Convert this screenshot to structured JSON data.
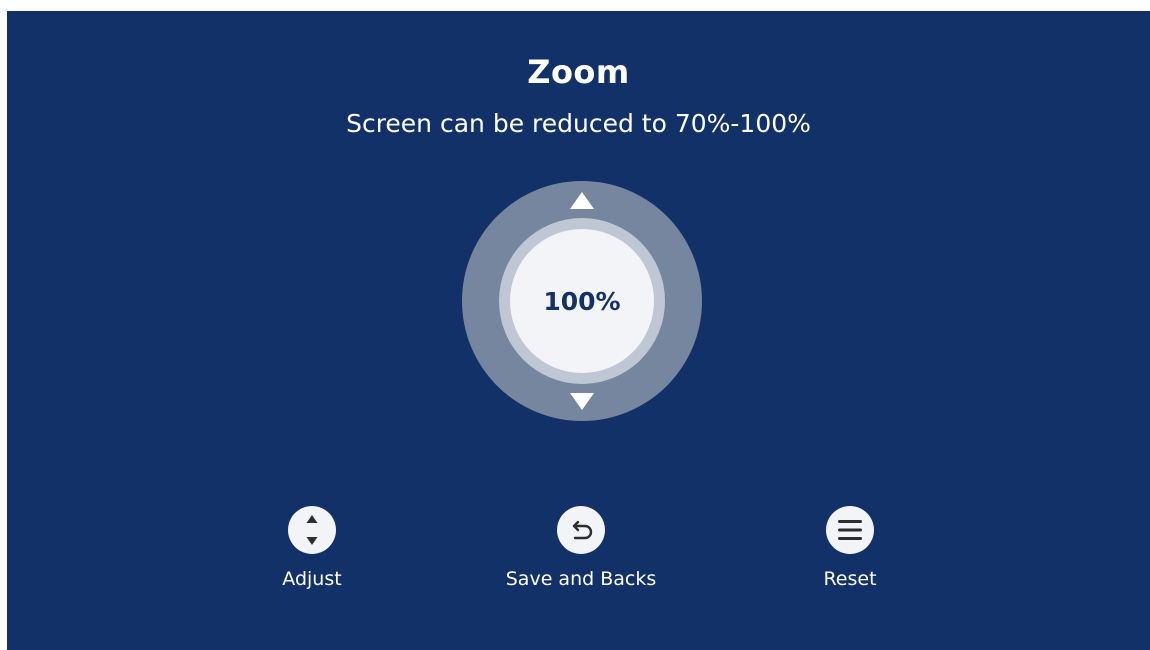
{
  "zoom": {
    "title": "Zoom",
    "subtitle": "Screen can be reduced to 70%-100%",
    "value_label": "100%",
    "value": 100,
    "range": [
      70,
      100
    ]
  },
  "hints": [
    {
      "label": "Adjust",
      "icon": "up-down-icon"
    },
    {
      "label": "Save and Backs",
      "icon": "return-icon"
    },
    {
      "label": "Reset",
      "icon": "menu-icon"
    }
  ],
  "colors": {
    "background": "#133169",
    "dial_outer": "#76869f",
    "dial_ring": "#c0c7d4",
    "dial_center": "#f3f4f7",
    "text": "#ffffff",
    "value_text": "#133169"
  }
}
